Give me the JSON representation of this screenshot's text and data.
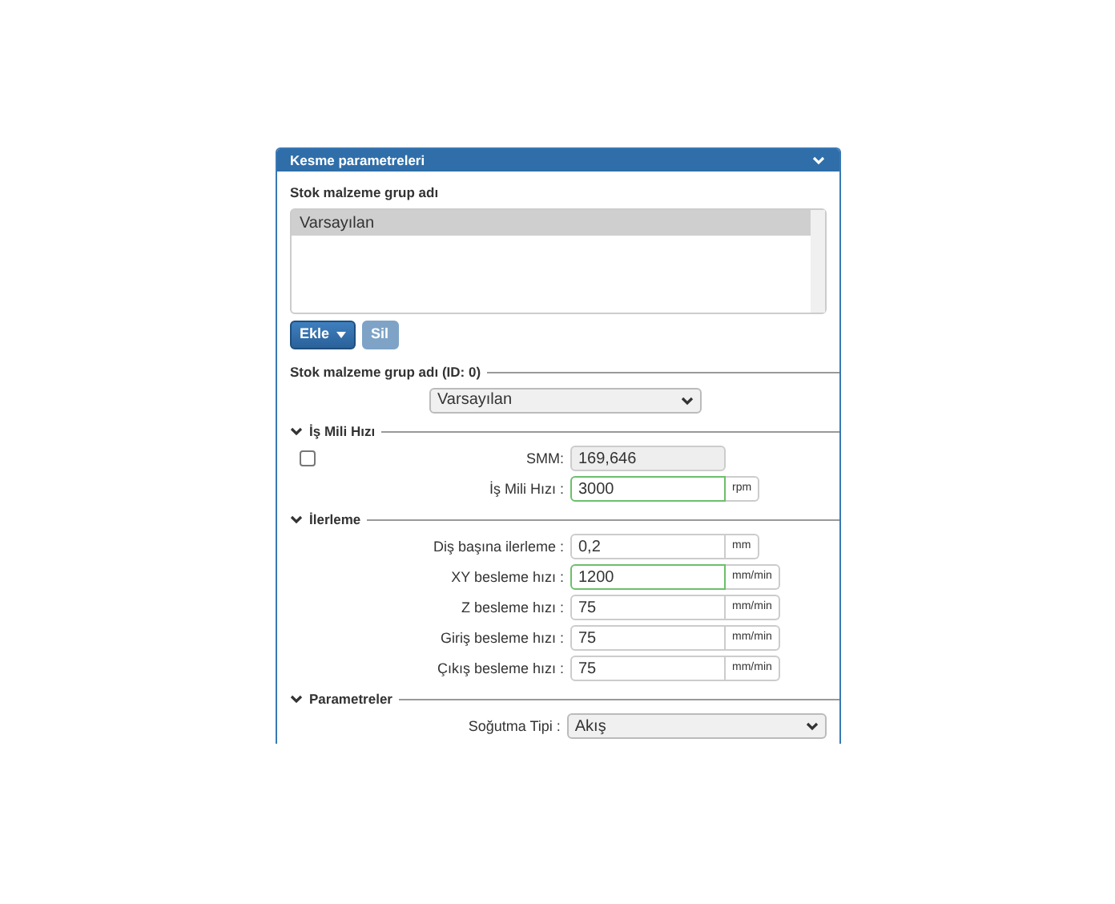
{
  "panel": {
    "title": "Kesme parametreleri",
    "expanded": true
  },
  "group_list": {
    "label": "Stok malzeme grup adı",
    "items": [
      {
        "text": "Varsayılan",
        "selected": true
      }
    ]
  },
  "buttons": [
    {
      "label": "Ekle",
      "kind": "dropdown",
      "disabled": false
    },
    {
      "label": "Sil",
      "kind": "plain",
      "disabled": true
    }
  ],
  "group_select": {
    "heading": "Stok malzeme grup adı (ID: 0)",
    "value": "Varsayılan"
  },
  "sections": [
    {
      "title": "İş Mili Hızı",
      "expanded": true,
      "checkbox": {
        "checked": false
      },
      "rows": [
        {
          "kind": "input",
          "label": "SMM:",
          "value": "169,646",
          "disabled": true,
          "highlighted": false
        },
        {
          "kind": "input",
          "label": "İş Mili Hızı :",
          "value": "3000",
          "unit": "rpm",
          "disabled": false,
          "highlighted": true
        }
      ]
    },
    {
      "title": "İlerleme",
      "expanded": true,
      "rows": [
        {
          "kind": "input",
          "label": "Diş başına ilerleme :",
          "value": "0,2",
          "unit": "mm",
          "disabled": false,
          "highlighted": false
        },
        {
          "kind": "input",
          "label": "XY besleme hızı :",
          "value": "1200",
          "unit": "mm/min",
          "disabled": false,
          "highlighted": true
        },
        {
          "kind": "input",
          "label": "Z besleme hızı :",
          "value": "75",
          "unit": "mm/min",
          "disabled": false,
          "highlighted": false
        },
        {
          "kind": "input",
          "label": "Giriş besleme hızı :",
          "value": "75",
          "unit": "mm/min",
          "disabled": false,
          "highlighted": false
        },
        {
          "kind": "input",
          "label": "Çıkış besleme hızı :",
          "value": "75",
          "unit": "mm/min",
          "disabled": false,
          "highlighted": false
        }
      ]
    },
    {
      "title": "Parametreler",
      "expanded": true,
      "rows": [
        {
          "kind": "select",
          "label": "Soğutma Tipi :",
          "value": "Akış"
        }
      ]
    }
  ]
}
